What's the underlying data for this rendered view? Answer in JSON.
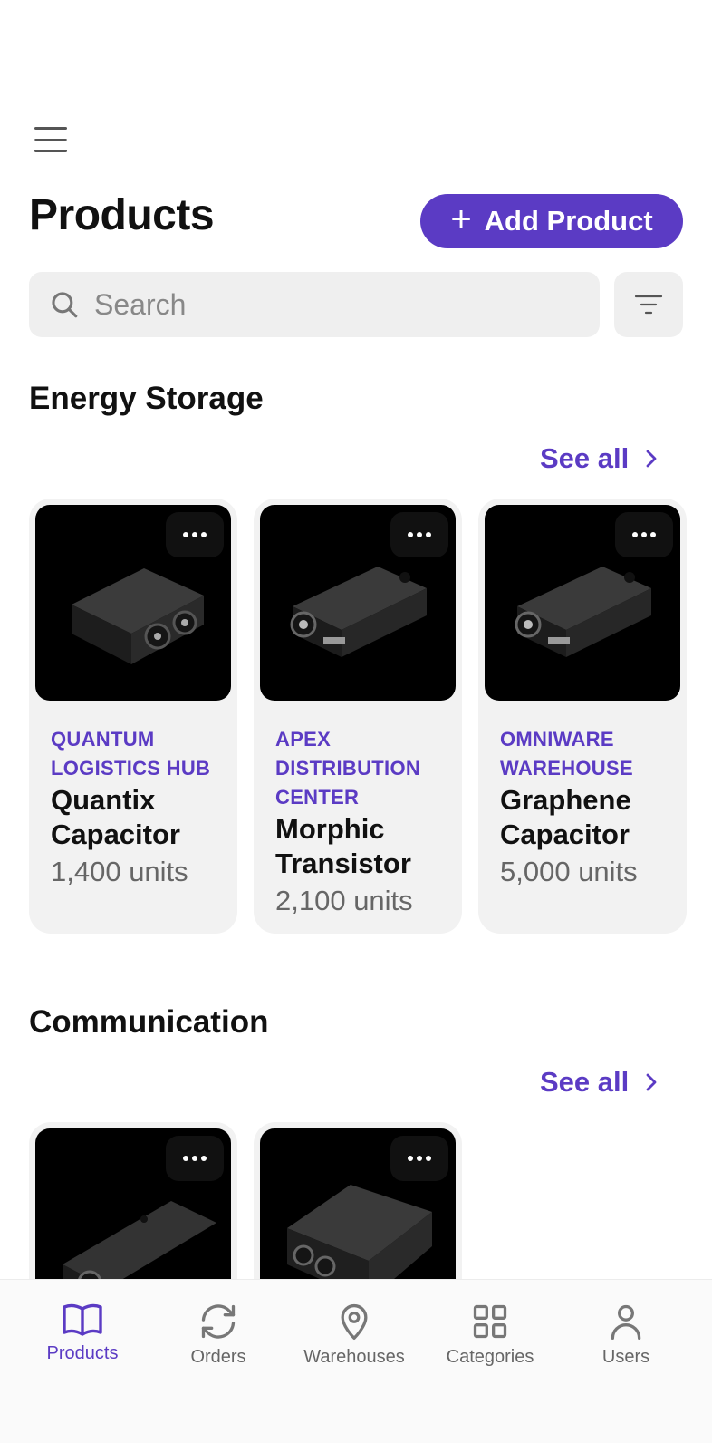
{
  "header": {
    "title": "Products",
    "add_label": "Add Product"
  },
  "search": {
    "placeholder": "Search",
    "value": ""
  },
  "colors": {
    "accent": "#5b3bc4",
    "card_bg": "#f2f2f2"
  },
  "sections": [
    {
      "title": "Energy Storage",
      "see_all": "See all",
      "products": [
        {
          "warehouse": "QUANTUM LOGISTICS HUB",
          "name": "Quantix Capacitor",
          "units": "1,400 units"
        },
        {
          "warehouse": "APEX DISTRIBUTION CENTER",
          "name": "Morphic Transistor",
          "units": "2,100 units"
        },
        {
          "warehouse": "OMNIWARE WAREHOUSE",
          "name": "Graphene Capacitor",
          "units": "5,000 units"
        }
      ]
    },
    {
      "title": "Communication",
      "see_all": "See all",
      "products": [
        {
          "warehouse": "",
          "name": "",
          "units": ""
        },
        {
          "warehouse": "",
          "name": "",
          "units": ""
        }
      ]
    }
  ],
  "tabbar": {
    "items": [
      {
        "label": "Products",
        "icon": "book-icon",
        "active": true
      },
      {
        "label": "Orders",
        "icon": "refresh-icon",
        "active": false
      },
      {
        "label": "Warehouses",
        "icon": "map-pin-icon",
        "active": false
      },
      {
        "label": "Categories",
        "icon": "grid-icon",
        "active": false
      },
      {
        "label": "Users",
        "icon": "user-icon",
        "active": false
      }
    ]
  }
}
